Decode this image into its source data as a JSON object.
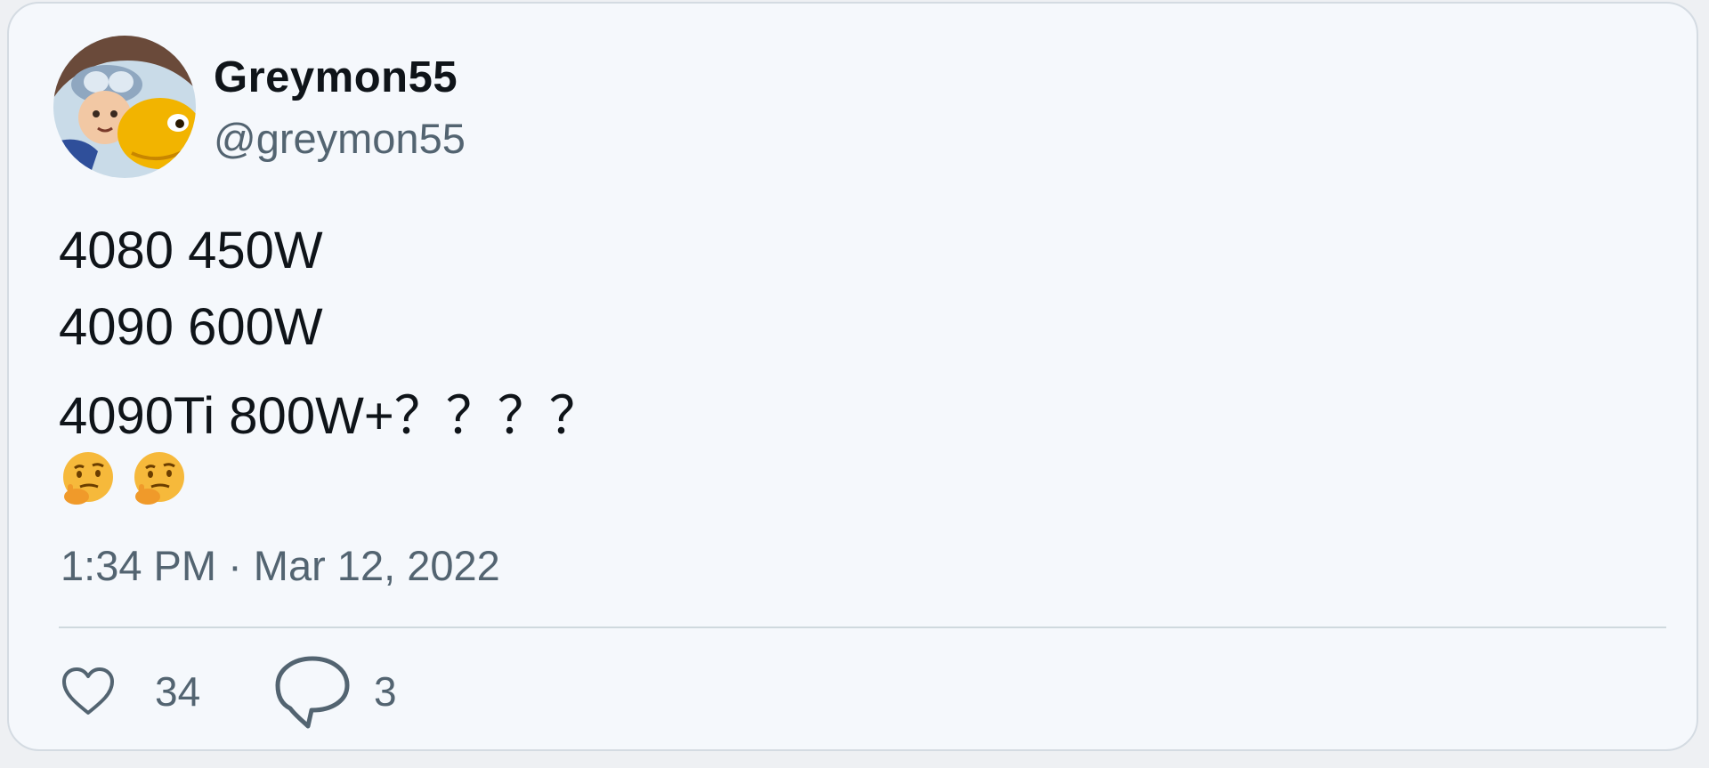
{
  "author": {
    "display_name": "Greymon55",
    "handle": "@greymon55",
    "avatar_icon": "cartoon-character-avatar"
  },
  "tweet": {
    "lines": [
      "4080 450W",
      "4090 600W",
      "4090Ti 800W+？？？？"
    ],
    "emojis": [
      "thinking-face-emoji",
      "thinking-face-emoji"
    ],
    "timestamp": "1:34 PM · Mar 12, 2022"
  },
  "actions": {
    "like": {
      "icon": "heart-outline-icon",
      "count": "34"
    },
    "reply": {
      "icon": "speech-bubble-icon",
      "count": "3"
    }
  },
  "colors": {
    "card_background": "#f5f8fc",
    "border": "#d4dbe2",
    "primary_text": "#0f1419",
    "secondary_text": "#536471",
    "emoji_yellow": "#f6b93b"
  }
}
